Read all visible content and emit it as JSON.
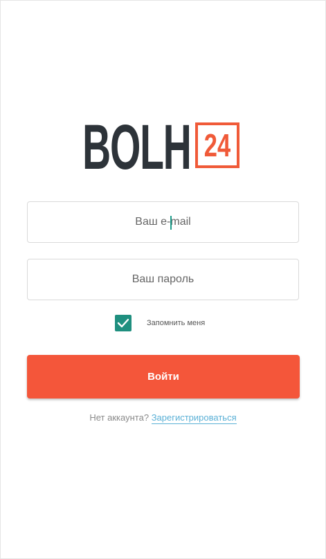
{
  "logo": {
    "word": "BOLH",
    "number": "24",
    "colors": {
      "word": "#2d3339",
      "accent": "#f05a38"
    }
  },
  "form": {
    "email_placeholder": "Ваш e-mail",
    "password_placeholder": "Ваш пароль",
    "remember_label": "Запомнить меня",
    "remember_checked": true,
    "submit_label": "Войти"
  },
  "signup": {
    "prompt": "Нет аккаунта?",
    "link_label": "Зарегистрироваться"
  },
  "colors": {
    "accent": "#f4563a",
    "checkbox": "#1f8f7f",
    "link": "#5ab0d6"
  }
}
